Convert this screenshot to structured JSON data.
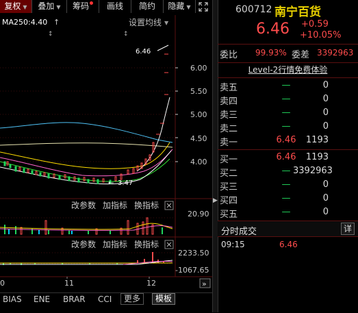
{
  "toolbar": {
    "tabs": [
      {
        "label": "复权",
        "caret": "▼",
        "selected": true
      },
      {
        "label": "叠加",
        "caret": "▼"
      },
      {
        "label": "筹码",
        "dot": true
      },
      {
        "label": "画线"
      },
      {
        "label": "简约"
      },
      {
        "label": "隐藏",
        "caret": "▼"
      }
    ],
    "expand_icon": "fullscreen-icon"
  },
  "chart": {
    "ma_label": "MA250:4.40",
    "ma_arrow": "↑",
    "settings_label": "设置均线",
    "settings_caret": "▼",
    "price_label": "6.46",
    "price_axis": [
      "6.00",
      "5.50",
      "5.00",
      "4.50",
      "4.00"
    ],
    "low_label": "3.47",
    "vol_panel": {
      "btn_params": "改参数",
      "btn_add": "加指标",
      "btn_switch": "换指标",
      "axis_top": "20.90"
    },
    "macd_panel": {
      "btn_params": "改参数",
      "btn_add": "加指标",
      "btn_switch": "换指标",
      "axis_top": "2233.50",
      "axis_bottom": "-1067.65"
    },
    "x_labels": [
      "0",
      "11",
      "12"
    ],
    "scroll_btn": "»"
  },
  "bottom_bar": {
    "items": [
      "BIAS",
      "ENE",
      "BRAR",
      "CCI",
      "更多",
      "模板"
    ]
  },
  "quote": {
    "code": "600712",
    "name": "南宁百货",
    "price": "6.46",
    "change": "+0.59",
    "change_pct": "+10.05%",
    "weibi_label": "委比",
    "weibi": "99.93%",
    "weicha_label": "委差",
    "weicha": "3392963",
    "level2": "Level-2行情免费体验",
    "asks": [
      {
        "label": "卖五",
        "price": "—",
        "vol": "0"
      },
      {
        "label": "卖四",
        "price": "—",
        "vol": "0"
      },
      {
        "label": "卖三",
        "price": "—",
        "vol": "0"
      },
      {
        "label": "卖二",
        "price": "—",
        "vol": "0"
      },
      {
        "label": "卖一",
        "price": "6.46",
        "vol": "1193"
      }
    ],
    "bids": [
      {
        "label": "买一",
        "price": "6.46",
        "vol": "1193"
      },
      {
        "label": "买二",
        "price": "—",
        "vol": "3392963"
      },
      {
        "label": "买三",
        "price": "—",
        "vol": "0"
      },
      {
        "label": "买四",
        "price": "—",
        "vol": "0"
      },
      {
        "label": "买五",
        "price": "—",
        "vol": "0"
      }
    ],
    "trades_title": "分时成交",
    "detail_btn": "详",
    "trades": [
      {
        "time": "09:15",
        "price": "6.46"
      }
    ]
  }
}
